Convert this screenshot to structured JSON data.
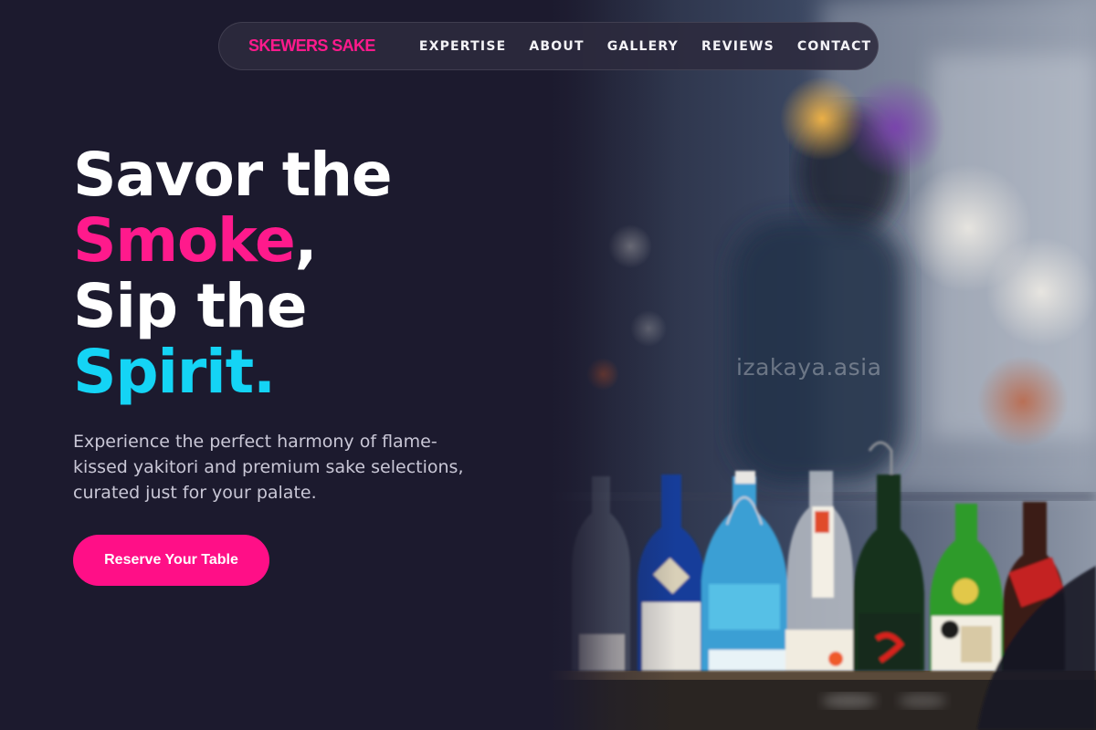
{
  "brand": {
    "name": "SKEWERS SAKE"
  },
  "nav": {
    "items": [
      {
        "label": "EXPERTISE"
      },
      {
        "label": "ABOUT"
      },
      {
        "label": "GALLERY"
      },
      {
        "label": "REVIEWS"
      },
      {
        "label": "CONTACT"
      }
    ]
  },
  "hero": {
    "headline": {
      "line1": "Savor the",
      "highlight1": "Smoke",
      "punct1": ",",
      "line3": "Sip the",
      "highlight2": "Spirit",
      "punct2": "."
    },
    "subtitle": "Experience the perfect harmony of flame-kissed yakitori and premium sake selections, curated just for your palate.",
    "cta_label": "Reserve Your Table",
    "image_watermark": "izakaya.asia"
  },
  "colors": {
    "background": "#1c1a2e",
    "accent_pink": "#ff1a8c",
    "accent_cyan": "#14d4f5",
    "text_muted": "#c9c7d6"
  },
  "icons": {
    "hero_image": "sake-bottles-bar-photo"
  }
}
